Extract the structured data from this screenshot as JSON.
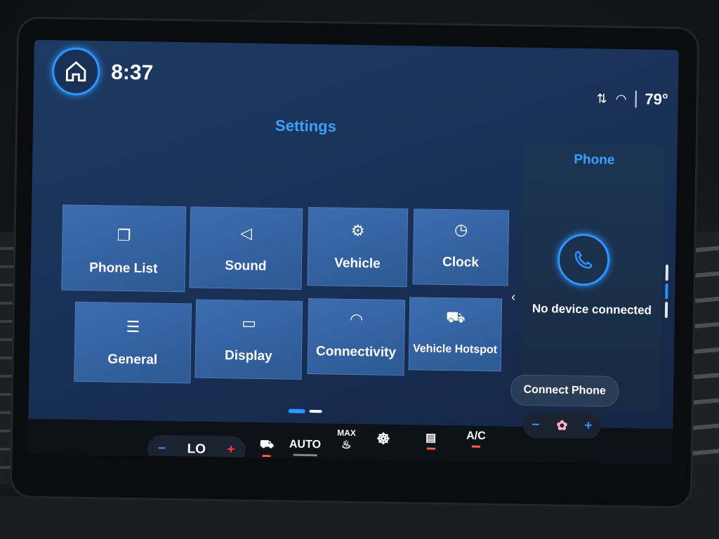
{
  "header": {
    "time": "8:37",
    "temperature": "79°"
  },
  "settings": {
    "title": "Settings",
    "tiles": [
      {
        "label": "Phone List",
        "icon": "phone-list-icon"
      },
      {
        "label": "Sound",
        "icon": "speaker-icon"
      },
      {
        "label": "Vehicle",
        "icon": "vehicle-settings-icon"
      },
      {
        "label": "Clock",
        "icon": "clock-icon"
      },
      {
        "label": "General",
        "icon": "sliders-icon"
      },
      {
        "label": "Display",
        "icon": "display-icon"
      },
      {
        "label": "Connectivity",
        "icon": "wifi-icon"
      },
      {
        "label": "Vehicle Hotspot",
        "icon": "vehicle-hotspot-icon"
      }
    ]
  },
  "phone": {
    "title": "Phone",
    "status": "No device connected",
    "connect_label": "Connect Phone"
  },
  "climate": {
    "temp_label": "LO",
    "minus": "−",
    "plus": "+",
    "auto_label": "AUTO",
    "max_label": "MAX",
    "ac_label": "A/C"
  },
  "colors": {
    "accent": "#2c95ff",
    "tile": "#3866a6",
    "screen": "#1a3157"
  }
}
